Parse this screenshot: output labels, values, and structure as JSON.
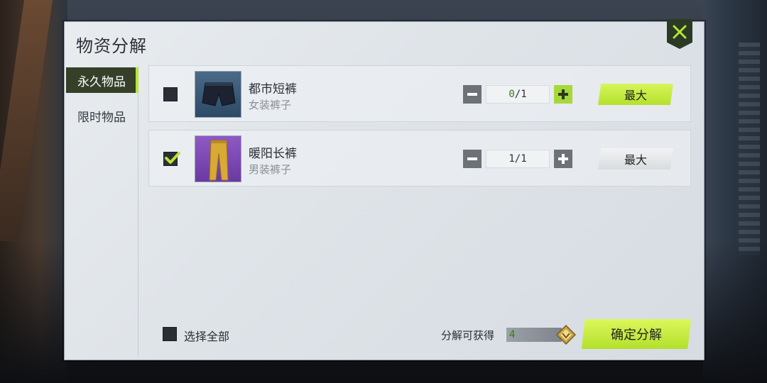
{
  "panel": {
    "title": "物资分解"
  },
  "tabs": [
    {
      "label": "永久物品",
      "active": true
    },
    {
      "label": "限时物品",
      "active": false
    }
  ],
  "items": [
    {
      "name": "都市短裤",
      "type": "女装裤子",
      "checked": false,
      "quantity_current": "0",
      "quantity_total": "/1",
      "max_label": "最大",
      "thumb_icon": "shorts-icon",
      "thumb_color": "#3d5d7c"
    },
    {
      "name": "暖阳长裤",
      "type": "男装裤子",
      "checked": true,
      "quantity_current": "1",
      "quantity_total": "/1",
      "max_label": "最大",
      "thumb_icon": "pants-icon",
      "thumb_color": "#7d4ab5"
    }
  ],
  "footer": {
    "select_all_label": "选择全部",
    "yield_label": "分解可获得",
    "yield_value": "4",
    "currency_icon": "diamond-currency-icon",
    "confirm_label": "确定分解"
  },
  "colors": {
    "accent": "#b8e534",
    "tab_active_bg": "#364029",
    "checkmark": "#b8e534"
  }
}
